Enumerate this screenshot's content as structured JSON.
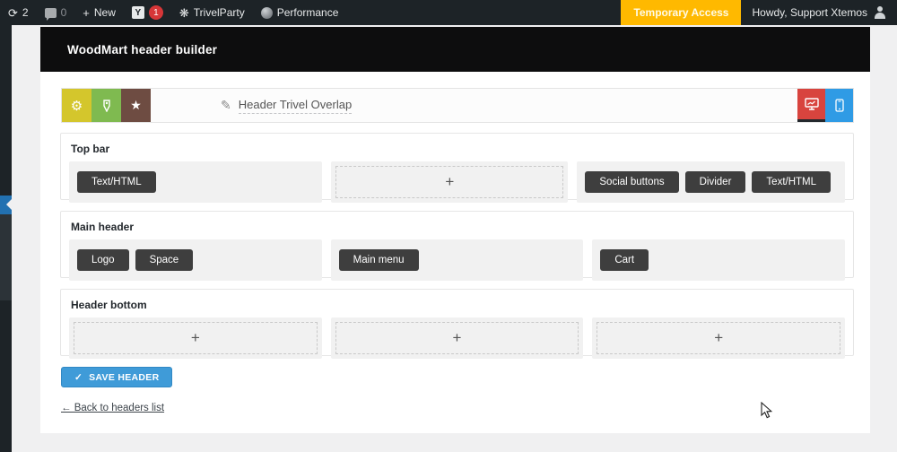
{
  "admin_bar": {
    "updates_count": "2",
    "comments_count": "0",
    "new_label": "New",
    "yoast_letter": "Y",
    "yoast_badge": "1",
    "site_label": "TrivelParty",
    "performance_label": "Performance",
    "temp_access_label": "Temporary Access",
    "howdy_label": "Howdy, Support Xtemos"
  },
  "page": {
    "title": "WoodMart header builder"
  },
  "toolbar": {
    "name_value": "Header Trivel Overlap",
    "icons": [
      "gear-icon",
      "tag-icon",
      "star-icon",
      "desktop-icon",
      "mobile-icon"
    ],
    "active_view": "desktop"
  },
  "builder": {
    "plus_sign": "+",
    "sections": [
      {
        "label": "Top bar",
        "columns": [
          [
            "Text/HTML"
          ],
          [],
          [
            "Social buttons",
            "Divider",
            "Text/HTML"
          ]
        ]
      },
      {
        "label": "Main header",
        "columns": [
          [
            "Logo",
            "Space"
          ],
          [
            "Main menu"
          ],
          [
            "Cart"
          ]
        ]
      },
      {
        "label": "Header bottom",
        "columns": [
          [],
          [],
          []
        ]
      }
    ]
  },
  "footer": {
    "save_label": "SAVE HEADER",
    "save_check": "✓",
    "back_link": "← Back to headers list"
  },
  "colors": {
    "admin_bar_bg": "#1d2327",
    "temp_access_orange": "#ffb900",
    "badge_red": "#d63638",
    "element_btn_dark": "#3e3e3e",
    "gear_yellow": "#d4c62c",
    "tag_green": "#7fba50",
    "star_brown": "#6e4c42",
    "desktop_red": "#d8443e",
    "mobile_blue": "#2f9be5",
    "save_blue": "#3f9bd8",
    "sidebar_active_blue": "#2271b1"
  }
}
